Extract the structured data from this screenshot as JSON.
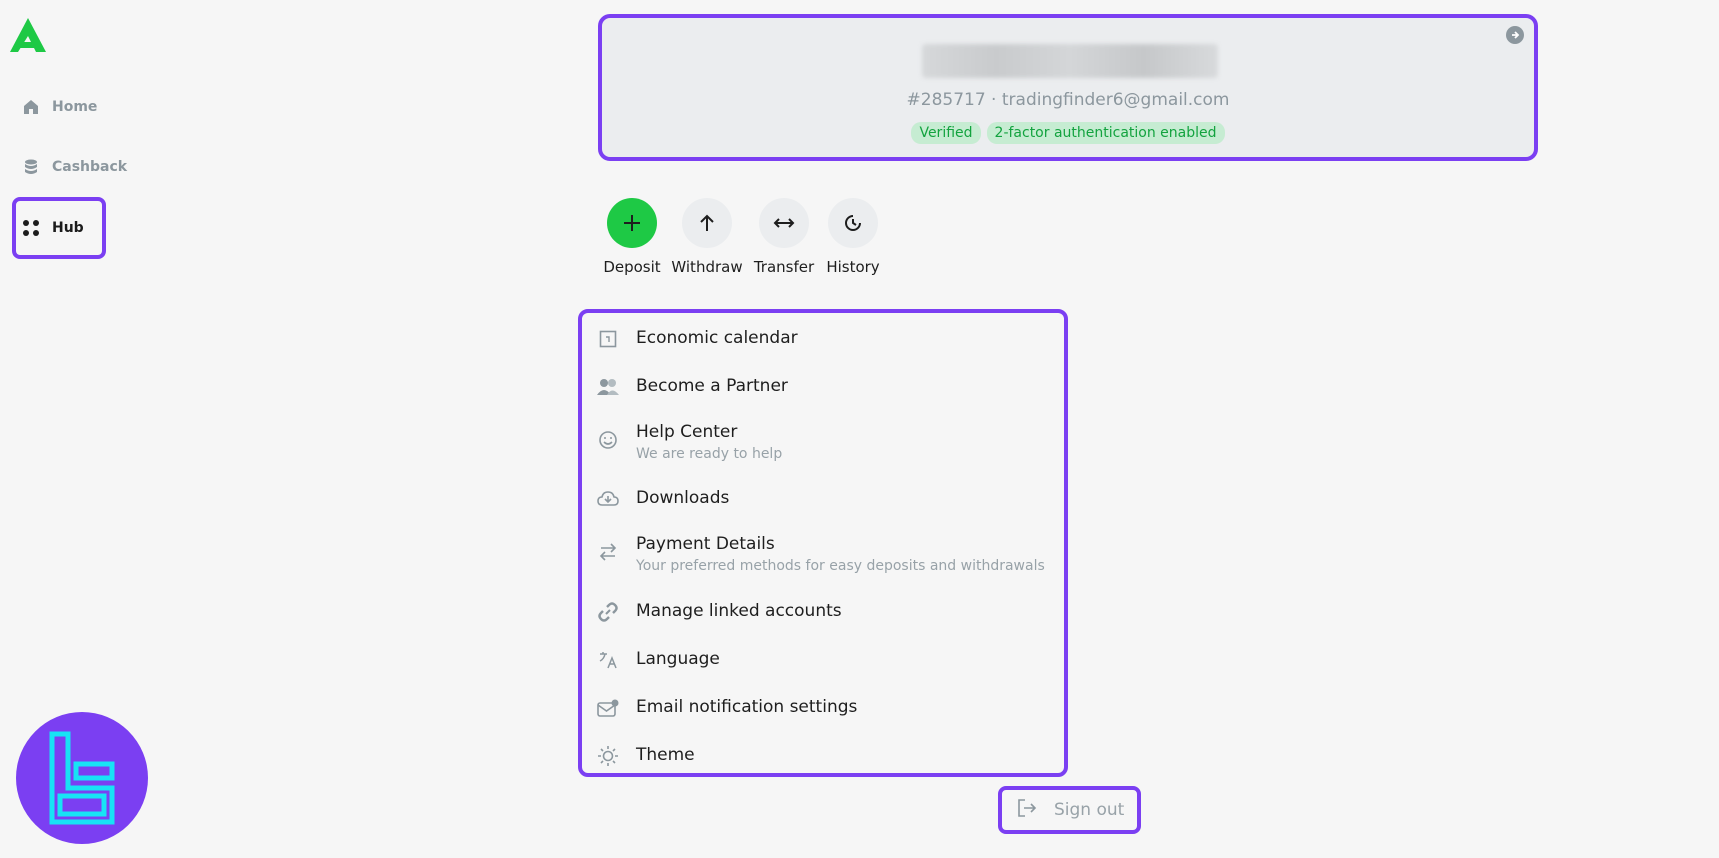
{
  "sidebar": {
    "items": [
      {
        "label": "Home",
        "icon": "home-icon"
      },
      {
        "label": "Cashback",
        "icon": "database-icon"
      },
      {
        "label": "Hub",
        "icon": "grid-dots-icon",
        "active": true
      }
    ]
  },
  "profile": {
    "ident": "#285717 · tradingfinder6@gmail.com",
    "tags": [
      "Verified",
      "2-factor authentication enabled"
    ]
  },
  "actions": [
    {
      "label": "Deposit",
      "icon": "plus-icon"
    },
    {
      "label": "Withdraw",
      "icon": "arrow-up-icon"
    },
    {
      "label": "Transfer",
      "icon": "arrows-horizontal-icon"
    },
    {
      "label": "History",
      "icon": "clock-icon"
    }
  ],
  "menu": [
    {
      "label": "Economic calendar",
      "sub": "",
      "icon": "calendar-icon"
    },
    {
      "label": "Become a Partner",
      "sub": "",
      "icon": "users-icon"
    },
    {
      "label": "Help Center",
      "sub": "We are ready to help",
      "icon": "smile-icon"
    },
    {
      "label": "Downloads",
      "sub": "",
      "icon": "cloud-download-icon"
    },
    {
      "label": "Payment Details",
      "sub": "Your preferred methods for easy deposits and withdrawals",
      "icon": "swap-icon"
    },
    {
      "label": "Manage linked accounts",
      "sub": "",
      "icon": "link-icon"
    },
    {
      "label": "Language",
      "sub": "",
      "icon": "translate-icon"
    },
    {
      "label": "Email notification settings",
      "sub": "",
      "icon": "mail-icon"
    },
    {
      "label": "Theme",
      "sub": "",
      "icon": "sun-icon"
    }
  ],
  "signout": {
    "label": "Sign out",
    "icon": "logout-icon"
  },
  "colors": {
    "accent": "#7b3ff2",
    "brand": "#1ec945",
    "tag_bg": "#c6ecd2",
    "tag_text": "#13a33f"
  }
}
